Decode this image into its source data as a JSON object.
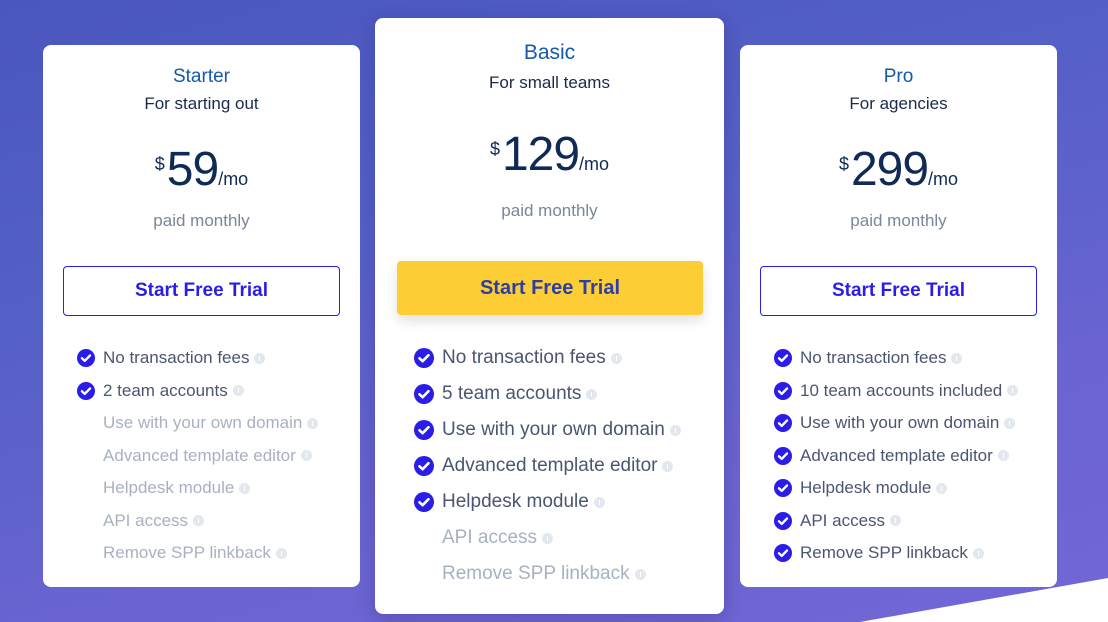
{
  "colors": {
    "accent": "#2b1de8",
    "plan_name": "#1559a8",
    "cta_highlight": "#fdcd35",
    "feature_on": "#4a5670",
    "feature_off": "#a7b1c2"
  },
  "plans": [
    {
      "name": "Starter",
      "tagline": "For starting out",
      "currency": "$",
      "price": "59",
      "period": "/mo",
      "billing": "paid monthly",
      "cta_label": "Start Free Trial",
      "cta_style": "outline",
      "features": [
        {
          "label": "No transaction fees",
          "included": true,
          "icon": "check-circle-icon",
          "info_icon": "info-icon"
        },
        {
          "label": "2 team accounts",
          "included": true,
          "icon": "check-circle-icon",
          "info_icon": "info-icon"
        },
        {
          "label": "Use with your own domain",
          "included": false,
          "info_icon": "info-icon"
        },
        {
          "label": "Advanced template editor",
          "included": false,
          "info_icon": "info-icon"
        },
        {
          "label": "Helpdesk module",
          "included": false,
          "info_icon": "info-icon"
        },
        {
          "label": "API access",
          "included": false,
          "info_icon": "info-icon"
        },
        {
          "label": "Remove SPP linkback",
          "included": false,
          "info_icon": "info-icon"
        }
      ]
    },
    {
      "name": "Basic",
      "tagline": "For small teams",
      "currency": "$",
      "price": "129",
      "period": "/mo",
      "billing": "paid monthly",
      "cta_label": "Start Free Trial",
      "cta_style": "primary",
      "features": [
        {
          "label": "No transaction fees",
          "included": true,
          "icon": "check-circle-icon",
          "info_icon": "info-icon"
        },
        {
          "label": "5 team accounts",
          "included": true,
          "icon": "check-circle-icon",
          "info_icon": "info-icon"
        },
        {
          "label": "Use with your own domain",
          "included": true,
          "icon": "check-circle-icon",
          "info_icon": "info-icon"
        },
        {
          "label": "Advanced template editor",
          "included": true,
          "icon": "check-circle-icon",
          "info_icon": "info-icon"
        },
        {
          "label": "Helpdesk module",
          "included": true,
          "icon": "check-circle-icon",
          "info_icon": "info-icon"
        },
        {
          "label": "API access",
          "included": false,
          "info_icon": "info-icon"
        },
        {
          "label": "Remove SPP linkback",
          "included": false,
          "info_icon": "info-icon"
        }
      ]
    },
    {
      "name": "Pro",
      "tagline": "For agencies",
      "currency": "$",
      "price": "299",
      "period": "/mo",
      "billing": "paid monthly",
      "cta_label": "Start Free Trial",
      "cta_style": "outline",
      "features": [
        {
          "label": "No transaction fees",
          "included": true,
          "icon": "check-circle-icon",
          "info_icon": "info-icon"
        },
        {
          "label": "10 team accounts included",
          "included": true,
          "icon": "check-circle-icon",
          "info_icon": "info-icon"
        },
        {
          "label": "Use with your own domain",
          "included": true,
          "icon": "check-circle-icon",
          "info_icon": "info-icon"
        },
        {
          "label": "Advanced template editor",
          "included": true,
          "icon": "check-circle-icon",
          "info_icon": "info-icon"
        },
        {
          "label": "Helpdesk module",
          "included": true,
          "icon": "check-circle-icon",
          "info_icon": "info-icon"
        },
        {
          "label": "API access",
          "included": true,
          "icon": "check-circle-icon",
          "info_icon": "info-icon"
        },
        {
          "label": "Remove SPP linkback",
          "included": true,
          "icon": "check-circle-icon",
          "info_icon": "info-icon"
        }
      ]
    }
  ]
}
